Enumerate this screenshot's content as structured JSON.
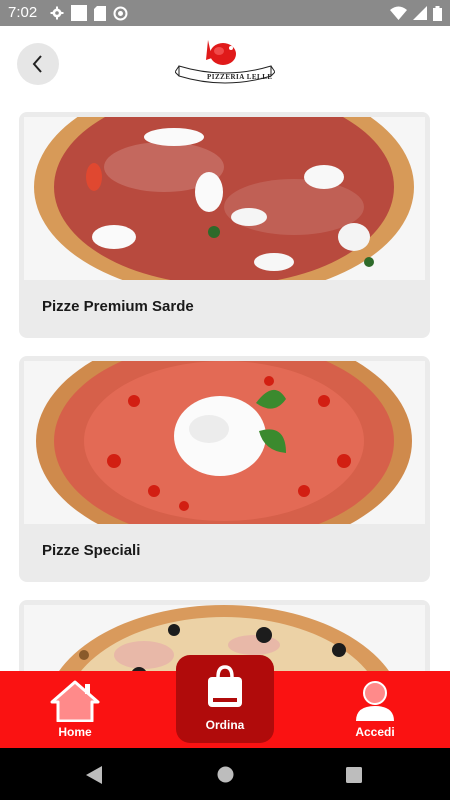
{
  "status_bar": {
    "time": "7:02",
    "icons": [
      "gear-icon",
      "square-icon",
      "sdcard-icon",
      "circle-slash-icon"
    ],
    "right_icons": [
      "wifi-icon",
      "signal-icon",
      "battery-icon"
    ]
  },
  "header": {
    "back_icon": "chevron-left-icon",
    "logo_text": "PIZZERIA LELLE"
  },
  "categories": [
    {
      "label": "Pizze Premium Sarde"
    },
    {
      "label": "Pizze Speciali"
    },
    {
      "label": ""
    }
  ],
  "bottom_nav": {
    "home_label": "Home",
    "order_label": "Ordina",
    "login_label": "Accedi"
  },
  "colors": {
    "accent": "#fa1212",
    "accent_dark": "#b00b0b",
    "card_bg": "#ebebeb"
  }
}
